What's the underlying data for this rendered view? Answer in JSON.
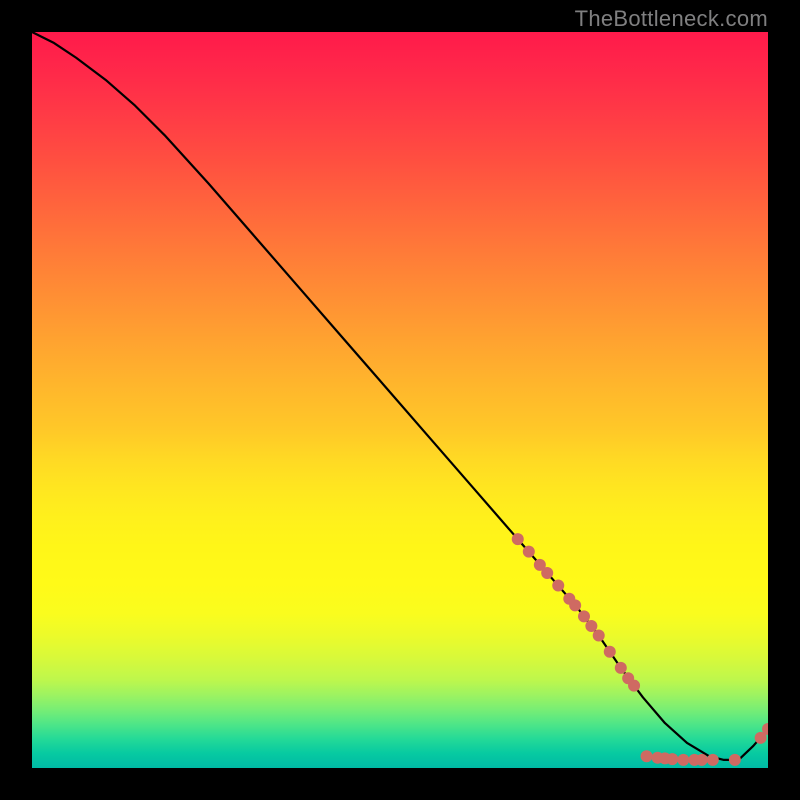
{
  "watermark": "TheBottleneck.com",
  "chart_data": {
    "type": "line",
    "title": "",
    "xlabel": "",
    "ylabel": "",
    "xlim": [
      0,
      100
    ],
    "ylim": [
      0,
      100
    ],
    "grid": false,
    "legend": false,
    "series": [
      {
        "name": "curve",
        "color": "#000000",
        "x": [
          0,
          3,
          6,
          10,
          14,
          18,
          24,
          30,
          36,
          42,
          48,
          54,
          60,
          66,
          70,
          74,
          77,
          80,
          83,
          86,
          89,
          92,
          94,
          96,
          98,
          100
        ],
        "y": [
          100,
          98.5,
          96.5,
          93.5,
          90,
          86,
          79.4,
          72.5,
          65.6,
          58.7,
          51.8,
          44.9,
          38.0,
          31.1,
          26.5,
          21.9,
          18.0,
          13.6,
          9.6,
          6.1,
          3.4,
          1.6,
          1.1,
          1.1,
          3.0,
          5.3
        ]
      }
    ],
    "markers": [
      {
        "name": "dots",
        "color": "#cf6a62",
        "radius_px": 6,
        "points": [
          {
            "x": 66.0,
            "y": 31.1
          },
          {
            "x": 67.5,
            "y": 29.4
          },
          {
            "x": 69.0,
            "y": 27.6
          },
          {
            "x": 70.0,
            "y": 26.5
          },
          {
            "x": 71.5,
            "y": 24.8
          },
          {
            "x": 73.0,
            "y": 23.0
          },
          {
            "x": 73.8,
            "y": 22.1
          },
          {
            "x": 75.0,
            "y": 20.6
          },
          {
            "x": 76.0,
            "y": 19.3
          },
          {
            "x": 77.0,
            "y": 18.0
          },
          {
            "x": 78.5,
            "y": 15.8
          },
          {
            "x": 80.0,
            "y": 13.6
          },
          {
            "x": 81.0,
            "y": 12.2
          },
          {
            "x": 81.8,
            "y": 11.2
          },
          {
            "x": 83.5,
            "y": 1.6
          },
          {
            "x": 85.0,
            "y": 1.4
          },
          {
            "x": 86.0,
            "y": 1.3
          },
          {
            "x": 87.0,
            "y": 1.2
          },
          {
            "x": 88.5,
            "y": 1.1
          },
          {
            "x": 90.0,
            "y": 1.1
          },
          {
            "x": 91.0,
            "y": 1.1
          },
          {
            "x": 92.5,
            "y": 1.1
          },
          {
            "x": 95.5,
            "y": 1.1
          },
          {
            "x": 99.0,
            "y": 4.1
          },
          {
            "x": 100.0,
            "y": 5.3
          }
        ]
      }
    ]
  }
}
